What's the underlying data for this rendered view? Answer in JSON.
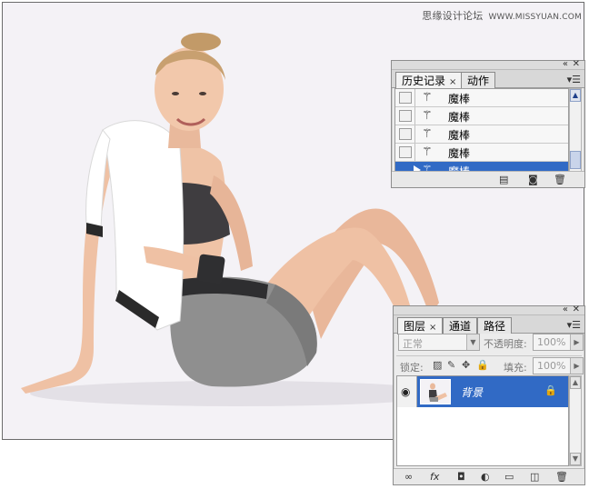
{
  "watermark": {
    "site": "思缘设计论坛",
    "url": "WWW.MISSYUAN.COM"
  },
  "history_panel": {
    "tabs": [
      {
        "label": "历史记录",
        "close": "×"
      },
      {
        "label": "动作"
      }
    ],
    "menu_icon": "panel-menu-icon",
    "items": [
      {
        "label": "魔棒",
        "icon": "magic-wand-icon"
      },
      {
        "label": "魔棒",
        "icon": "magic-wand-icon"
      },
      {
        "label": "魔棒",
        "icon": "magic-wand-icon"
      },
      {
        "label": "魔棒",
        "icon": "magic-wand-icon"
      },
      {
        "label": "魔棒",
        "icon": "magic-wand-icon",
        "selected": true
      }
    ],
    "footer_icons": [
      "new-document-from-state-icon",
      "camera-snapshot-icon",
      "trash-icon"
    ]
  },
  "layers_panel": {
    "tabs": [
      {
        "label": "图层",
        "close": "×"
      },
      {
        "label": "通道"
      },
      {
        "label": "路径"
      }
    ],
    "blend_mode": "正常",
    "opacity_label": "不透明度:",
    "opacity_value": "100%",
    "lock_label": "锁定:",
    "fill_label": "填充:",
    "fill_value": "100%",
    "layers": [
      {
        "name": "背景",
        "visible": true,
        "locked": true,
        "selected": true
      }
    ],
    "footer_icons": [
      "link-icon",
      "fx-icon",
      "mask-icon",
      "adjustment-icon",
      "folder-icon",
      "new-layer-icon",
      "trash-icon"
    ]
  },
  "colors": {
    "selection": "#316ac5",
    "canvas_bg": "#f4f2f6",
    "panel_bg": "#ececec"
  }
}
